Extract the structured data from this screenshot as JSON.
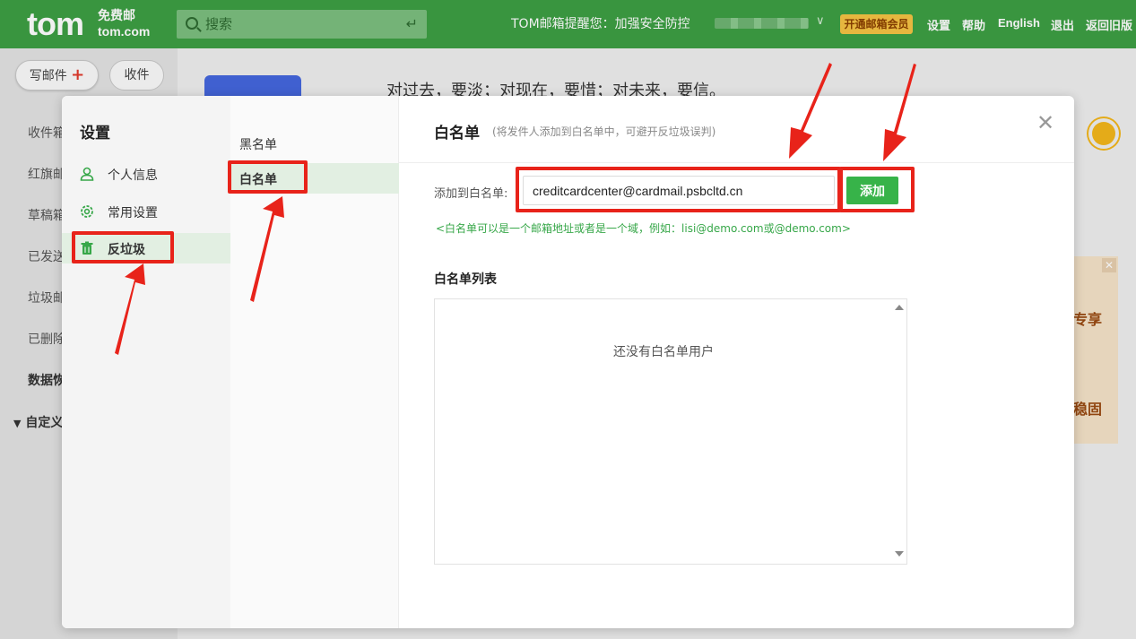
{
  "topbar": {
    "logo_text": "tom",
    "logo_line1": "免费邮",
    "logo_line2": "tom.com",
    "search_placeholder": "搜索",
    "notice": "TOM邮箱提醒您：加强安全防控",
    "vip_label": "开通邮箱会员",
    "links": [
      "设置",
      "帮助",
      "English",
      "退出",
      "返回旧版"
    ]
  },
  "left_panel": {
    "compose_label": "写邮件",
    "inbox_label": "收件",
    "folders": [
      "收件箱",
      "红旗邮",
      "草稿箱",
      "已发送",
      "垃圾邮",
      "已删除",
      "数据恢",
      "自定义"
    ]
  },
  "main_bg": {
    "quote": "对过去，要淡；对现在，要惜；对未来，要信。",
    "ad_text_1": "专享",
    "ad_text_2": "稳固"
  },
  "settings": {
    "title": "设置",
    "nav1": [
      {
        "label": "个人信息",
        "icon": "user-icon"
      },
      {
        "label": "常用设置",
        "icon": "gear-icon"
      },
      {
        "label": "反垃圾",
        "icon": "trash-icon"
      }
    ],
    "nav2": [
      "黑名单",
      "白名单"
    ],
    "content": {
      "title": "白名单",
      "subtitle": "(将发件人添加到白名单中，可避开反垃圾误判)",
      "add_label": "添加到白名单:",
      "add_value": "creditcardcenter@cardmail.psbcltd.cn",
      "add_button": "添加",
      "hint": "<白名单可以是一个邮箱地址或者是一个域，例如：lisi@demo.com或@demo.com>",
      "list_title": "白名单列表",
      "empty_text": "还没有白名单用户"
    }
  },
  "colors": {
    "brand_green": "#3d9f43",
    "button_green": "#37b349",
    "highlight_red": "#e8231a"
  }
}
